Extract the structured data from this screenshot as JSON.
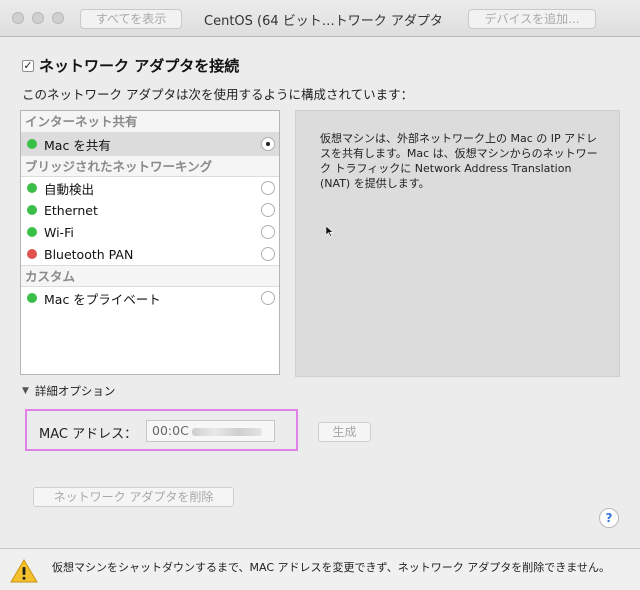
{
  "window": {
    "title": "CentOS (64 ビット…トワーク アダプタ",
    "show_all_label": "すべてを表示",
    "add_device_label": "デバイスを追加..."
  },
  "connect": {
    "checked": true,
    "check_glyph": "✓",
    "label": "ネットワーク アダプタを接続"
  },
  "description": "このネットワーク アダプタは次を使用するように構成されています：",
  "list": {
    "groups": [
      {
        "header": "インターネット共有",
        "items": [
          {
            "label": "Mac を共有",
            "status": "green",
            "selected": true
          }
        ]
      },
      {
        "header": "ブリッジされたネットワーキング",
        "items": [
          {
            "label": "自動検出",
            "status": "green",
            "selected": false
          },
          {
            "label": "Ethernet",
            "status": "green",
            "selected": false
          },
          {
            "label": "Wi-Fi",
            "status": "green",
            "selected": false
          },
          {
            "label": "Bluetooth PAN",
            "status": "red",
            "selected": false
          }
        ]
      },
      {
        "header": "カスタム",
        "items": [
          {
            "label": "Mac をプライベート",
            "status": "green",
            "selected": false
          }
        ]
      }
    ]
  },
  "info_text": "仮想マシンは、外部ネットワーク上の Mac の IP アドレスを共有します。Mac は、仮想マシンからのネットワーク トラフィックに Network Address Translation (NAT) を提供します。",
  "advanced": {
    "label": "詳細オプション",
    "expanded": true
  },
  "mac": {
    "label": "MAC アドレス：",
    "value_visible": "00:0C"
  },
  "buttons": {
    "generate": "生成",
    "delete_adapter": "ネットワーク アダプタを削除",
    "help": "?"
  },
  "footer": {
    "warning": "仮想マシンをシャットダウンするまで、MAC アドレスを変更できず、ネットワーク アダプタを削除できません。"
  },
  "colors": {
    "status_green": "#3cbf4a",
    "status_red": "#e0524f",
    "highlight_border": "#e083e6",
    "help_blue": "#3478d8",
    "warning_yellow": "#f5c02b"
  }
}
